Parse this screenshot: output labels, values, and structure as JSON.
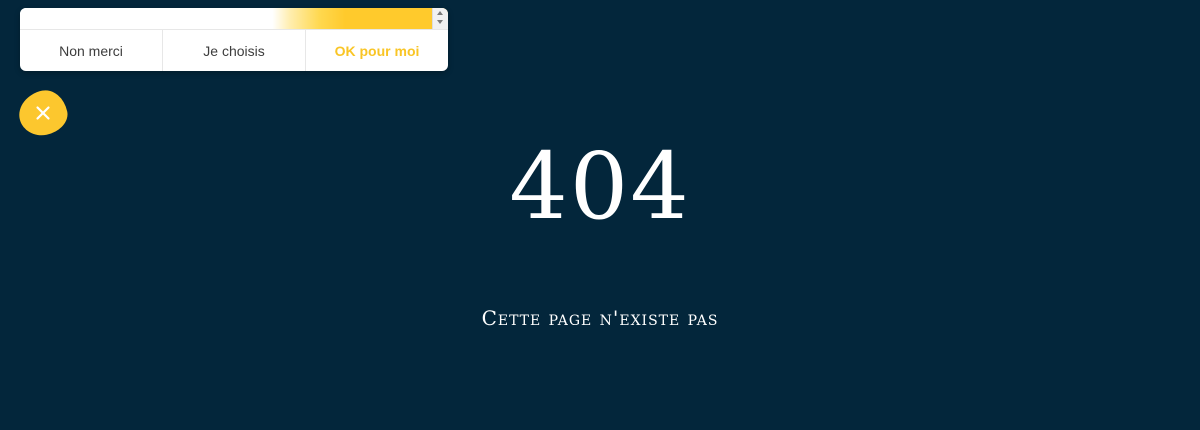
{
  "consent": {
    "buttons": {
      "decline": "Non merci",
      "customize": "Je choisis",
      "accept": "OK pour moi"
    },
    "accent_color": "#ffca2c"
  },
  "close_button": {
    "icon": "close-icon",
    "color": "#fcc72e"
  },
  "error": {
    "code": "404",
    "message": "Cette page n'existe pas"
  },
  "colors": {
    "background": "#03263b",
    "text": "#ffffff"
  }
}
